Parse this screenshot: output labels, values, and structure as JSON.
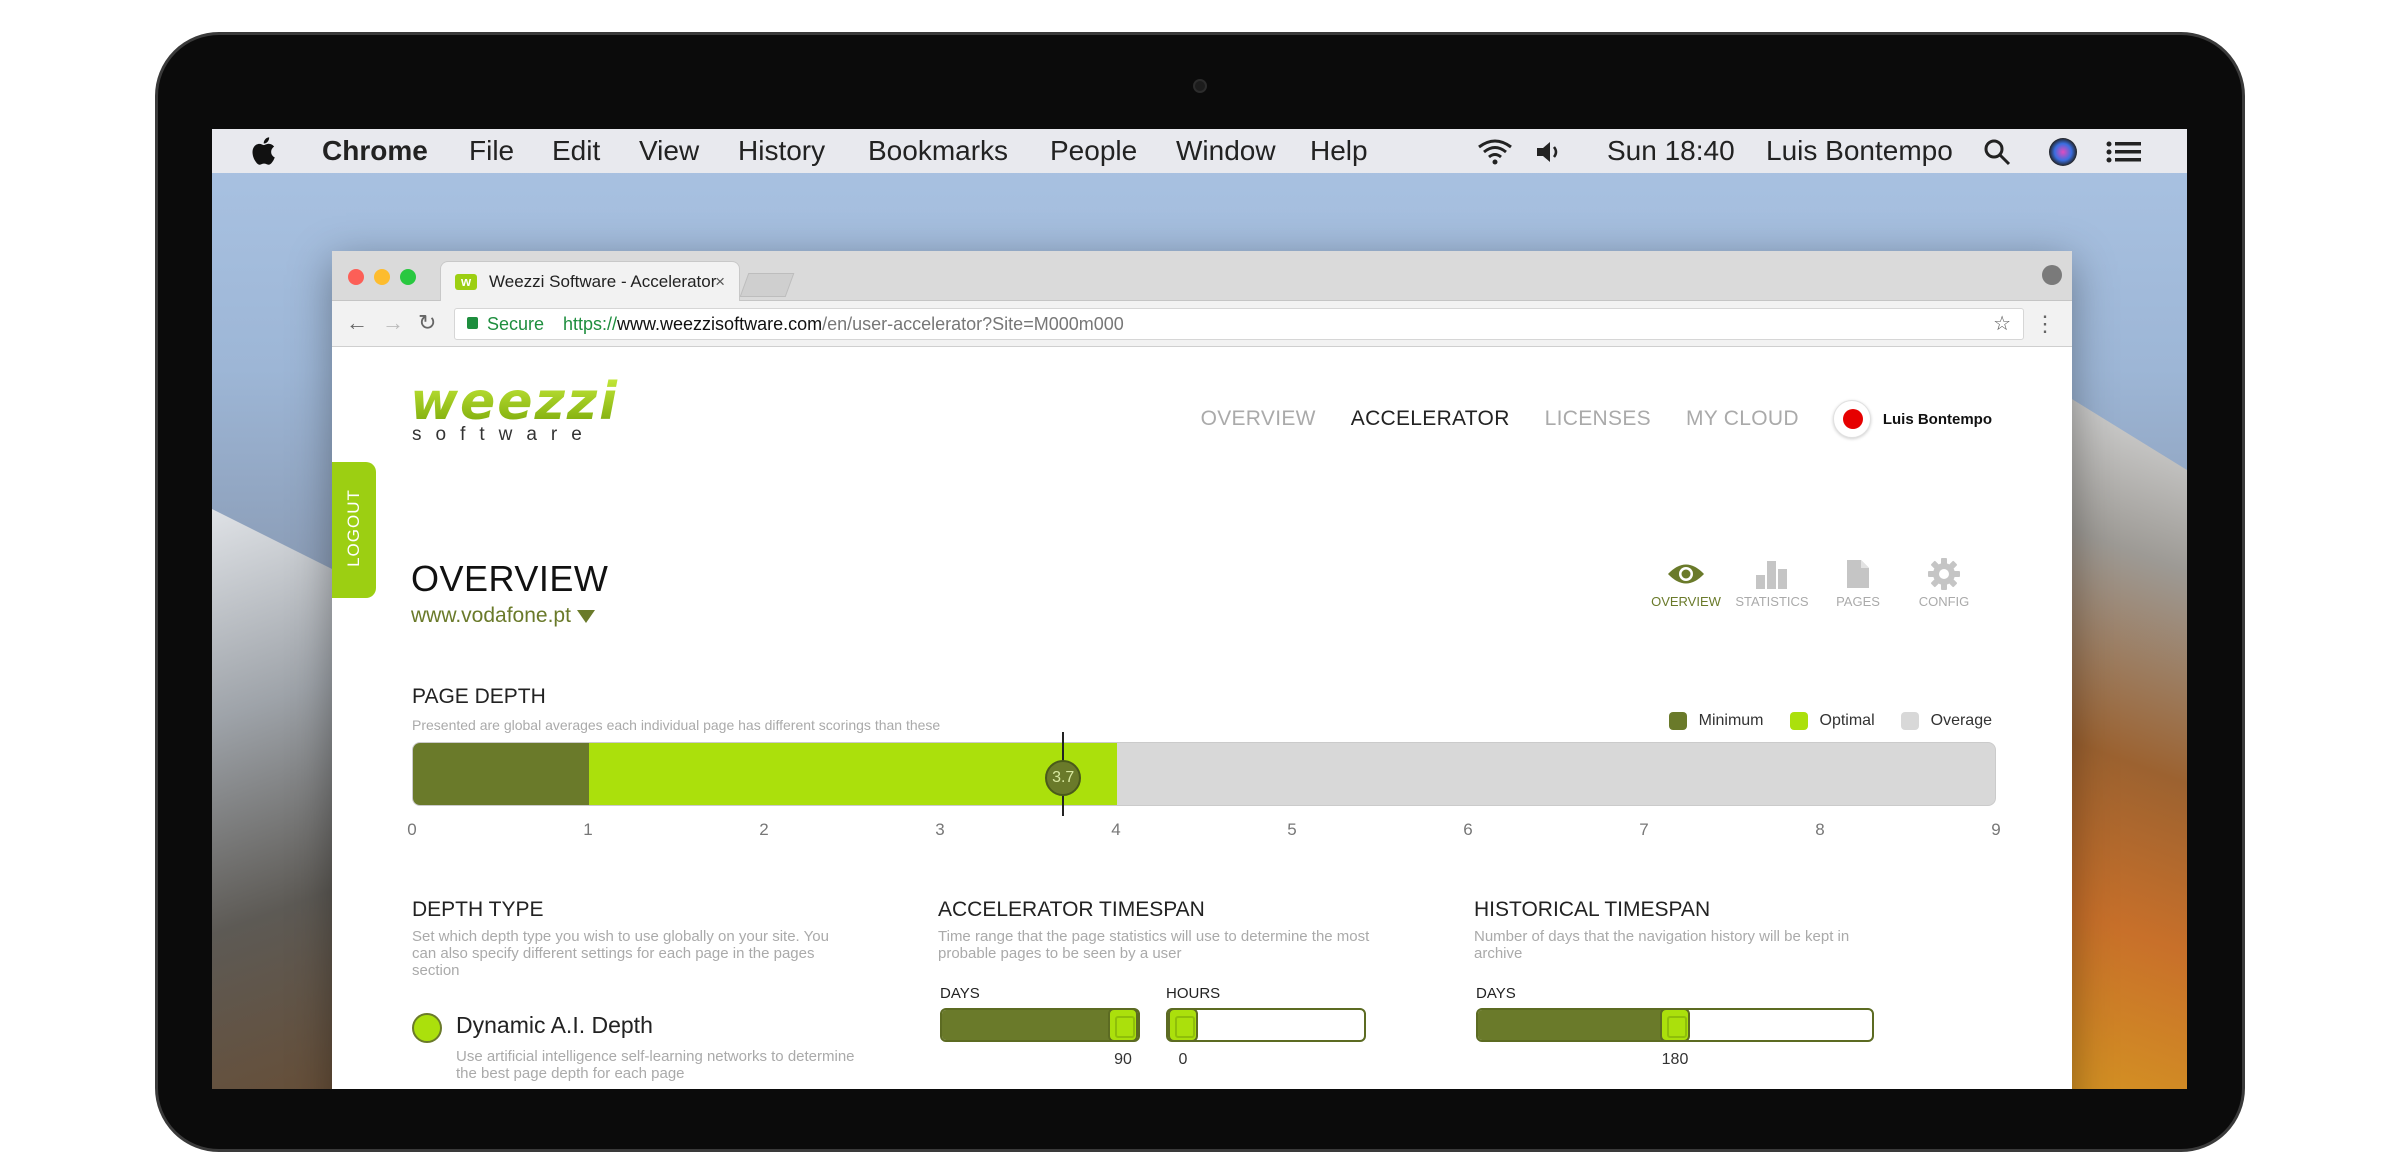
{
  "menubar": {
    "app": "Chrome",
    "items": [
      "File",
      "Edit",
      "View",
      "History",
      "Bookmarks",
      "People",
      "Window",
      "Help"
    ],
    "clock": "Sun 18:40",
    "user": "Luis Bontempo"
  },
  "browser": {
    "tab_title": "Weezzi Software - Accelerator",
    "tab_close": "×",
    "secure_label": "Secure",
    "url_protocol": "https://",
    "url_host": "www.weezzisoftware.com",
    "url_path": "/en/user-accelerator?Site=M000m000"
  },
  "header": {
    "logo_main": "weezzi",
    "logo_sub": "software",
    "nav": [
      {
        "label": "OVERVIEW",
        "active": false
      },
      {
        "label": "ACCELERATOR",
        "active": true
      },
      {
        "label": "LICENSES",
        "active": false
      },
      {
        "label": "MY CLOUD",
        "active": false
      }
    ],
    "user_name": "Luis Bontempo",
    "logout_label": "LOGOUT"
  },
  "overview": {
    "title": "OVERVIEW",
    "site": "www.vodafone.pt",
    "view_tabs": [
      {
        "label": "OVERVIEW",
        "icon": "eye-icon",
        "active": true
      },
      {
        "label": "STATISTICS",
        "icon": "bar-chart-icon",
        "active": false
      },
      {
        "label": "PAGES",
        "icon": "document-icon",
        "active": false
      },
      {
        "label": "CONFIG",
        "icon": "gear-icon",
        "active": false
      }
    ]
  },
  "page_depth": {
    "title": "PAGE DEPTH",
    "subtitle": "Presented are global averages each individual page has different scorings than these",
    "legend": [
      {
        "label": "Minimum",
        "color": "#6a7a2a"
      },
      {
        "label": "Optimal",
        "color": "#abe00c"
      },
      {
        "label": "Overage",
        "color": "#d8d8d8"
      }
    ],
    "min_end": 1,
    "optimal_end": 4,
    "max": 9,
    "current": 3.7,
    "current_label": "3.7",
    "ticks": [
      "0",
      "1",
      "2",
      "3",
      "4",
      "5",
      "6",
      "7",
      "8",
      "9"
    ]
  },
  "depth_type": {
    "title": "DEPTH TYPE",
    "desc": "Set which depth type you wish to use globally on your site. You can also specify different settings for each page in the pages section",
    "option_label": "Dynamic A.I. Depth",
    "option_desc": "Use artificial intelligence self-learning networks to determine the best page depth for each page"
  },
  "accelerator_timespan": {
    "title": "ACCELERATOR TIMESPAN",
    "desc": "Time range that the page statistics will use to determine the most probable pages to be seen by a user",
    "days_label": "DAYS",
    "days_value": "90",
    "days_fraction": 1.0,
    "hours_label": "HOURS",
    "hours_value": "0",
    "hours_fraction": 0.0
  },
  "historical_timespan": {
    "title": "HISTORICAL TIMESPAN",
    "desc": "Number of days that the navigation history will be kept in archive",
    "days_label": "DAYS",
    "days_value": "180",
    "days_fraction": 0.5
  }
}
